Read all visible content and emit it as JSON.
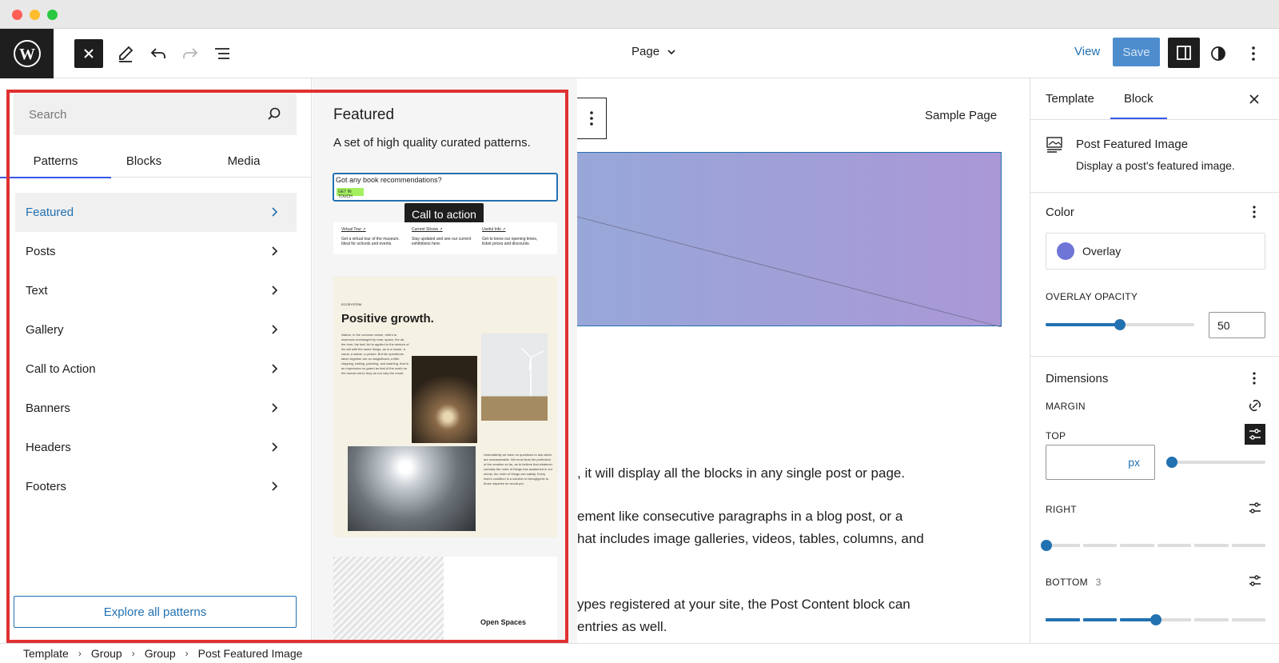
{
  "toolbar": {
    "document_title": "Page",
    "view_label": "View",
    "save_label": "Save"
  },
  "inserter": {
    "search_placeholder": "Search",
    "tabs": [
      {
        "label": "Patterns",
        "active": true
      },
      {
        "label": "Blocks",
        "active": false
      },
      {
        "label": "Media",
        "active": false
      }
    ],
    "categories": [
      {
        "label": "Featured",
        "active": true
      },
      {
        "label": "Posts",
        "active": false
      },
      {
        "label": "Text",
        "active": false
      },
      {
        "label": "Gallery",
        "active": false
      },
      {
        "label": "Call to Action",
        "active": false
      },
      {
        "label": "Banners",
        "active": false
      },
      {
        "label": "Headers",
        "active": false
      },
      {
        "label": "Footers",
        "active": false
      }
    ],
    "explore_label": "Explore all patterns",
    "panel": {
      "title": "Featured",
      "description": "A set of high quality curated patterns.",
      "tooltip": "Call to action",
      "pattern1": {
        "question": "Got any book recommendations?",
        "button": "GET IN TOUCH"
      },
      "pattern2": {
        "columns": [
          {
            "title": "Virtual Tour ↗",
            "text": "Get a virtual tour of the museum. Ideal for schools and events."
          },
          {
            "title": "Current Shows ↗",
            "text": "Stay updated and see our current exhibitions here."
          },
          {
            "title": "Useful Info ↗",
            "text": "Get to know our opening times, ticket prices and discounts."
          }
        ]
      },
      "pattern3": {
        "eyebrow": "ECOSYSTEM",
        "heading": "Positive growth.",
        "body": "Nature, in the common sense, refers to essences unchanged by man; space, the air, the river, the leaf. Art is applied to the mixture of his will with the same things, as in a house, a canal, a statue, a picture. But his operations taken together are so insignificant, a little chipping, baking, patching, and washing, that in an impression so grand as that of the world on the human mind, they do not vary the result.",
        "body2": "Undoubtedly we have no questions to ask which are unanswerable. We must trust the perfection of the creation so far, as to believe that whatever curiosity the order of things has awakened in our minds, the order of things can satisfy. Every man's condition is a solution in hieroglyphic to those inquiries he would put."
      },
      "pattern4": {
        "label": "Open Spaces"
      }
    }
  },
  "canvas": {
    "nav_item": "Sample Page",
    "paragraphs": [
      ", it will display all the blocks in any single post or page.",
      "ement like consecutive paragraphs in a blog post, or a",
      "hat includes image galleries, videos, tables, columns, and",
      "ypes registered at your site, the Post Content block can",
      "entries as well."
    ]
  },
  "settings": {
    "tabs": [
      {
        "label": "Template",
        "active": false
      },
      {
        "label": "Block",
        "active": true
      }
    ],
    "block_name": "Post Featured Image",
    "block_description": "Display a post's featured image.",
    "color_heading": "Color",
    "overlay_label": "Overlay",
    "overlay_color": "#6f75d6",
    "overlay_opacity_label": "OVERLAY OPACITY",
    "overlay_opacity_value": "50",
    "dimensions_heading": "Dimensions",
    "margin_label": "MARGIN",
    "top_label": "TOP",
    "top_unit": "px",
    "right_label": "RIGHT",
    "bottom_label": "BOTTOM",
    "bottom_value": "3"
  },
  "breadcrumb": [
    "Template",
    "Group",
    "Group",
    "Post Featured Image"
  ],
  "colors": {
    "accent": "#2271b1",
    "tab_indicator": "#3858e9",
    "highlight_frame": "#e03131"
  }
}
